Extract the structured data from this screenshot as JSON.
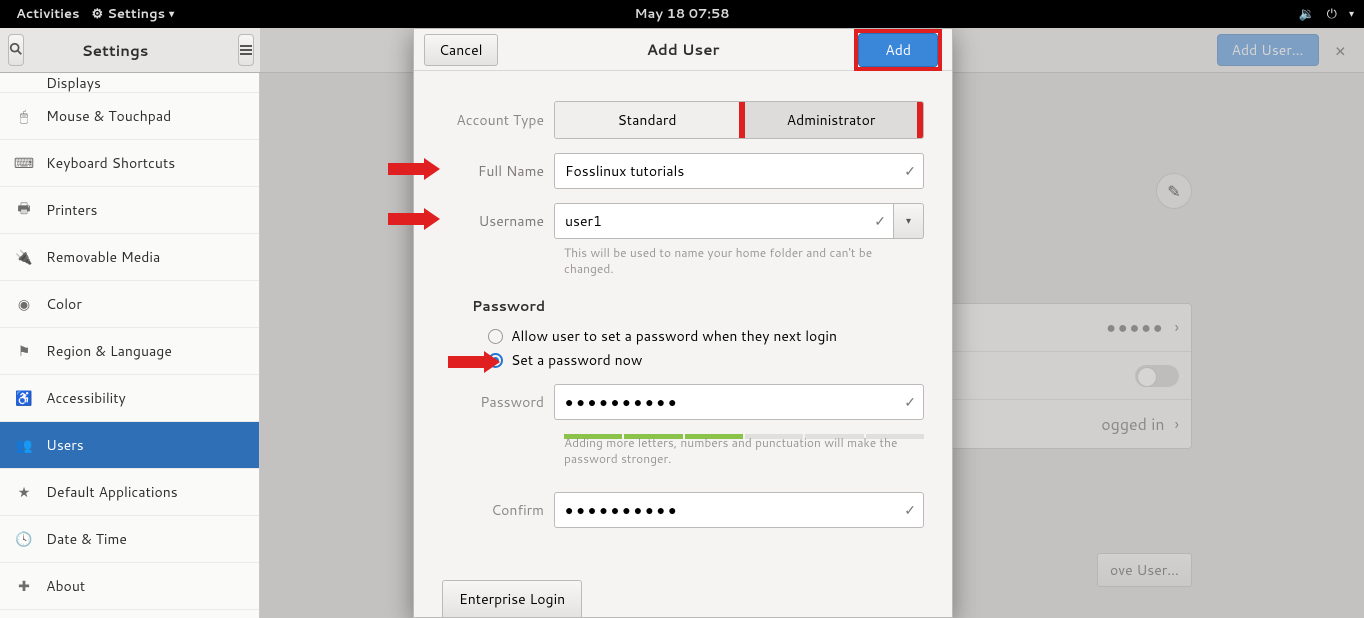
{
  "topbar": {
    "activities": "Activities",
    "app_menu": "Settings",
    "clock": "May 18  07:58"
  },
  "settings_header": {
    "title": "Settings",
    "add_user_btn": "Add User…",
    "close": "×"
  },
  "sidebar": {
    "partial_top": "Displays",
    "items": [
      {
        "icon": "mouse",
        "label": "Mouse & Touchpad"
      },
      {
        "icon": "keyboard",
        "label": "Keyboard Shortcuts"
      },
      {
        "icon": "printer",
        "label": "Printers"
      },
      {
        "icon": "usb",
        "label": "Removable Media"
      },
      {
        "icon": "color",
        "label": "Color"
      },
      {
        "icon": "flag",
        "label": "Region & Language"
      },
      {
        "icon": "access",
        "label": "Accessibility"
      },
      {
        "icon": "users",
        "label": "Users",
        "active": true
      },
      {
        "icon": "star",
        "label": "Default Applications"
      },
      {
        "icon": "clock",
        "label": "Date & Time"
      },
      {
        "icon": "plus",
        "label": "About"
      }
    ]
  },
  "users_panel": {
    "password_masked": "●●●●●",
    "logged_in": "ogged in",
    "remove_user": "ove User…"
  },
  "dialog": {
    "cancel": "Cancel",
    "title": "Add User",
    "add": "Add",
    "account_type_label": "Account Type",
    "standard": "Standard",
    "administrator": "Administrator",
    "full_name_label": "Full Name",
    "full_name_value": "Fosslinux tutorials",
    "username_label": "Username",
    "username_value": "user1",
    "username_hint": "This will be used to name your home folder and can't be changed.",
    "password_section": "Password",
    "radio_later": "Allow user to set a password when they next login",
    "radio_now": "Set a password now",
    "password_label": "Password",
    "password_value": "●●●●●●●●●●",
    "password_hint": "Adding more letters, numbers and punctuation will make the password stronger.",
    "confirm_label": "Confirm",
    "confirm_value": "●●●●●●●●●●",
    "enterprise": "Enterprise Login"
  }
}
